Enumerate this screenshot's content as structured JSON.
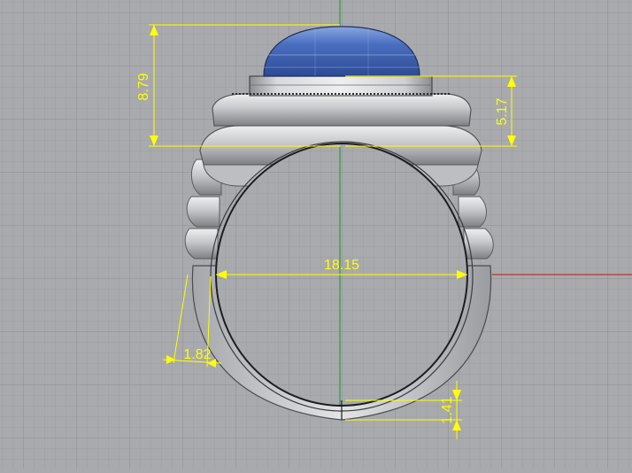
{
  "viewport": {
    "view": "front",
    "colors": {
      "background": "#a9aaad",
      "grid_minor": "#9c9da0",
      "grid_major": "#8e8f92",
      "axis_x": "#b23a2e",
      "axis_y": "#2e9a3a",
      "dimension": "#ffff00",
      "stone": "#3f63b4",
      "metal": "#c8c9cc"
    }
  },
  "dimensions": [
    {
      "id": "stone-height",
      "text": "8.79"
    },
    {
      "id": "bezel-height",
      "text": "5.17"
    },
    {
      "id": "inner-diameter",
      "text": "18.15"
    },
    {
      "id": "shoulder-thickness",
      "text": "1.82"
    },
    {
      "id": "shank-thickness",
      "text": "1.41"
    }
  ]
}
